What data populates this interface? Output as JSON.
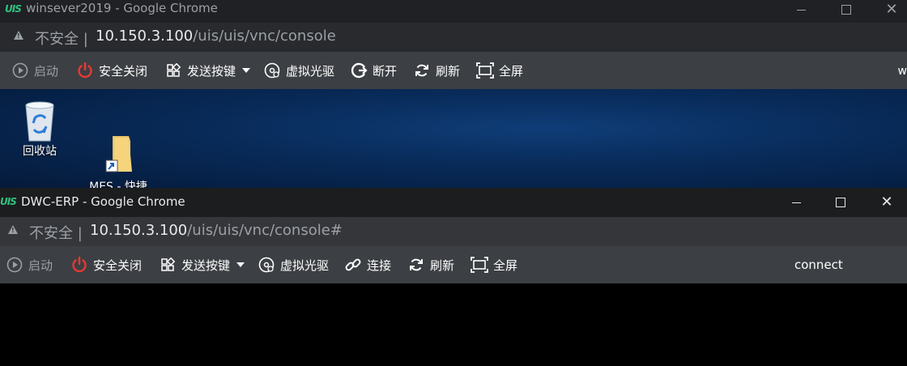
{
  "back_window": {
    "logo": "UIS",
    "title": "winsever2019 - Google Chrome",
    "address": {
      "security_label": "不安全",
      "host": "10.150.3.100",
      "path": "/uis/uis/vnc/console"
    },
    "toolbar": {
      "start": "启动",
      "safe_shutdown": "安全关闭",
      "send_hotkey": "发送按键",
      "virtual_cdrom": "虚拟光驱",
      "disconnect": "断开",
      "refresh": "刷新",
      "fullscreen": "全屏",
      "edge_text": "w"
    },
    "desktop_icons": [
      {
        "label": "回收站",
        "icon": "recycle-bin-icon"
      },
      {
        "label": "MES - 快捷\n方式",
        "icon": "folder-shortcut-icon"
      }
    ]
  },
  "front_window": {
    "logo": "UIS",
    "title": "DWC-ERP - Google Chrome",
    "address": {
      "security_label": "不安全",
      "host": "10.150.3.100",
      "path": "/uis/uis/vnc/console#"
    },
    "toolbar": {
      "start": "启动",
      "safe_shutdown": "安全关闭",
      "send_hotkey": "发送按键",
      "virtual_cdrom": "虚拟光驱",
      "connect": "连接",
      "refresh": "刷新",
      "fullscreen": "全屏"
    },
    "status": "connect"
  },
  "colors": {
    "power_red": "#e53935",
    "logo_green": "#2ec27e",
    "toolbar_bg": "#3c3f43"
  }
}
